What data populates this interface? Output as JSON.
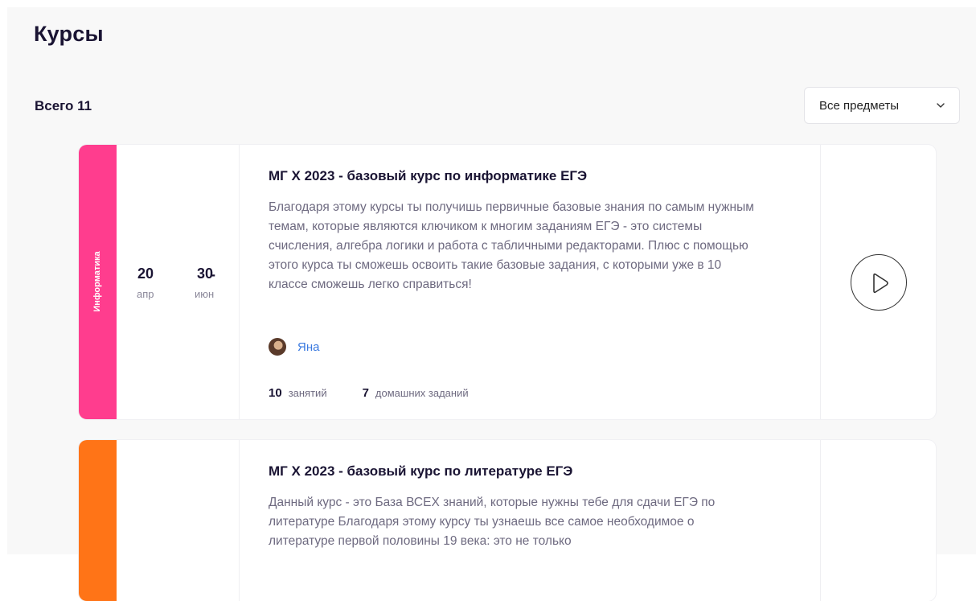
{
  "page": {
    "title": "Курсы",
    "total_label": "Всего 11"
  },
  "filter": {
    "selected": "Все предметы",
    "icon": "chevron-down-icon"
  },
  "colors": {
    "informatics": "#ff3d8e",
    "literature": "#ff7417",
    "link": "#3b7ae0"
  },
  "courses": [
    {
      "subject": "Информатика",
      "start_day": "20",
      "start_month": "апр",
      "end_day": "30",
      "end_month": "июн",
      "date_sep": "-",
      "title": "МГ Х 2023 - базовый курс по информатике ЕГЭ",
      "description": "Благодаря этому курсы ты получишь первичные базовые знания по самым нужным темам, которые являются ключиком к многим заданиям ЕГЭ - это системы счисления, алгебра логики и работа с табличными редакторами. Плюс с помощью этого курса ты сможешь освоить такие базовые задания, с которыми уже в 10 классе сможешь легко справиться!",
      "teacher": "Яна",
      "lessons_count": "10",
      "lessons_label": "занятий",
      "homework_count": "7",
      "homework_label": "домашних заданий",
      "action_icon": "play-icon"
    },
    {
      "subject": "",
      "title": "МГ Х 2023 - базовый курс по литературе ЕГЭ",
      "description": "Данный курс - это База ВСЕХ знаний, которые нужны тебе для сдачи ЕГЭ по литературе Благодаря этому курсу ты узнаешь все самое необходимое о литературе первой половины 19 века: это не только"
    }
  ]
}
